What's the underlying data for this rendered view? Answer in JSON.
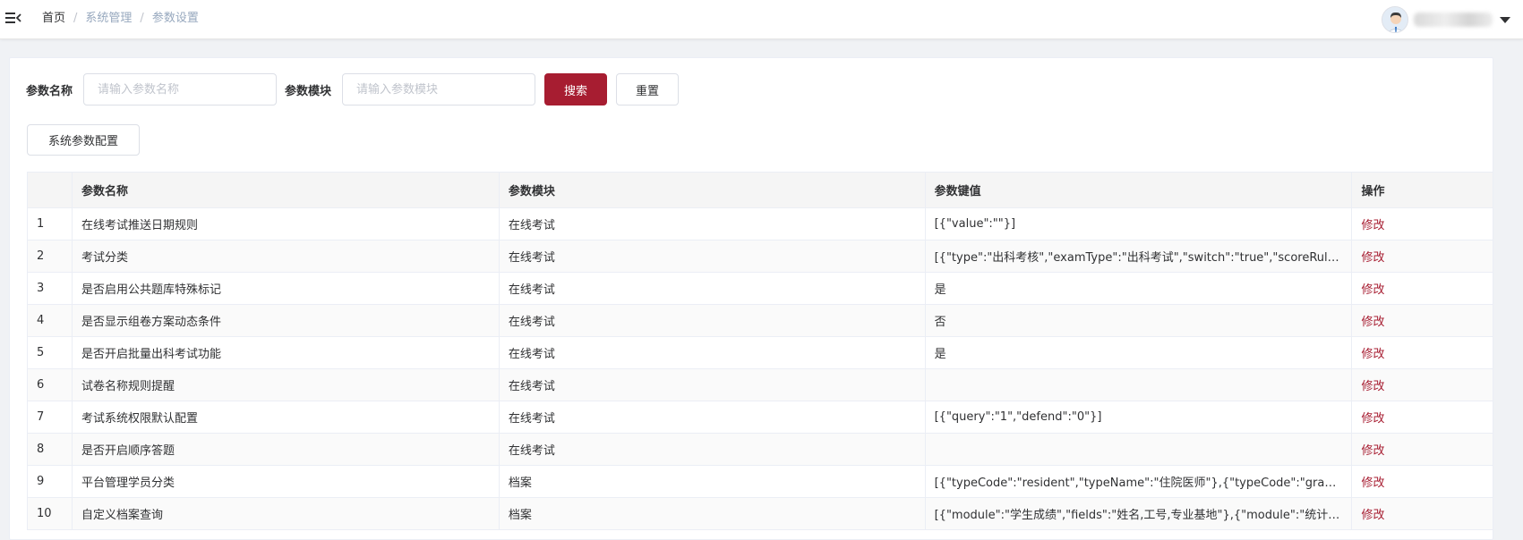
{
  "breadcrumb": {
    "home": "首页",
    "sep": "/",
    "level2": "系统管理",
    "level3": "参数设置"
  },
  "search": {
    "name_label": "参数名称",
    "name_placeholder": "请输入参数名称",
    "module_label": "参数模块",
    "module_placeholder": "请输入参数模块",
    "search_button": "搜索",
    "reset_button": "重置"
  },
  "toolbar": {
    "config_button": "系统参数配置"
  },
  "colors": {
    "primary": "#a71d31"
  },
  "table": {
    "headers": [
      "",
      "参数名称",
      "参数模块",
      "参数键值",
      "操作"
    ],
    "rows": [
      {
        "index": "1",
        "name": "在线考试推送日期规则",
        "module": "在线考试",
        "value": "[{\"value\":\"\"}]",
        "action": "修改"
      },
      {
        "index": "2",
        "name": "考试分类",
        "module": "在线考试",
        "value": "[{\"type\":\"出科考核\",\"examType\":\"出科考试\",\"switch\":\"true\",\"scoreRules\":...",
        "action": "修改"
      },
      {
        "index": "3",
        "name": "是否启用公共题库特殊标记",
        "module": "在线考试",
        "value": "是",
        "action": "修改"
      },
      {
        "index": "4",
        "name": "是否显示组卷方案动态条件",
        "module": "在线考试",
        "value": "否",
        "action": "修改"
      },
      {
        "index": "5",
        "name": "是否开启批量出科考试功能",
        "module": "在线考试",
        "value": "是",
        "action": "修改"
      },
      {
        "index": "6",
        "name": "试卷名称规则提醒",
        "module": "在线考试",
        "value": "",
        "action": "修改"
      },
      {
        "index": "7",
        "name": "考试系统权限默认配置",
        "module": "在线考试",
        "value": "[{\"query\":\"1\",\"defend\":\"0\"}]",
        "action": "修改"
      },
      {
        "index": "8",
        "name": "是否开启顺序答题",
        "module": "在线考试",
        "value": "",
        "action": "修改"
      },
      {
        "index": "9",
        "name": "平台管理学员分类",
        "module": "档案",
        "value": "[{\"typeCode\":\"resident\",\"typeName\":\"住院医师\"},{\"typeCode\":\"graduate...",
        "action": "修改"
      },
      {
        "index": "10",
        "name": "自定义档案查询",
        "module": "档案",
        "value": "[{\"module\":\"学生成绩\",\"fields\":\"姓名,工号,专业基地\"},{\"module\":\"统计分...",
        "action": "修改"
      }
    ]
  }
}
